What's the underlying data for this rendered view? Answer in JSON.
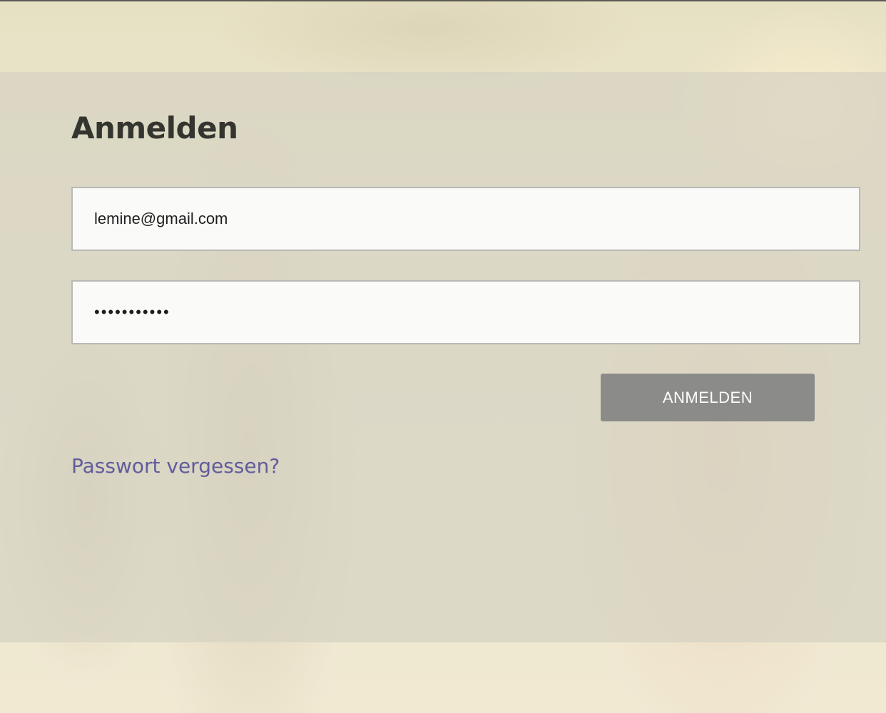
{
  "login": {
    "title": "Anmelden",
    "email_value": "lemine@gmail.com",
    "password_value": "lemine123@!",
    "submit_label": "ANMELDEN",
    "forgot_password_label": "Passwort vergessen?"
  },
  "colors": {
    "button_background": "#8b8b89",
    "link": "#625c9c",
    "title": "#35352f"
  }
}
